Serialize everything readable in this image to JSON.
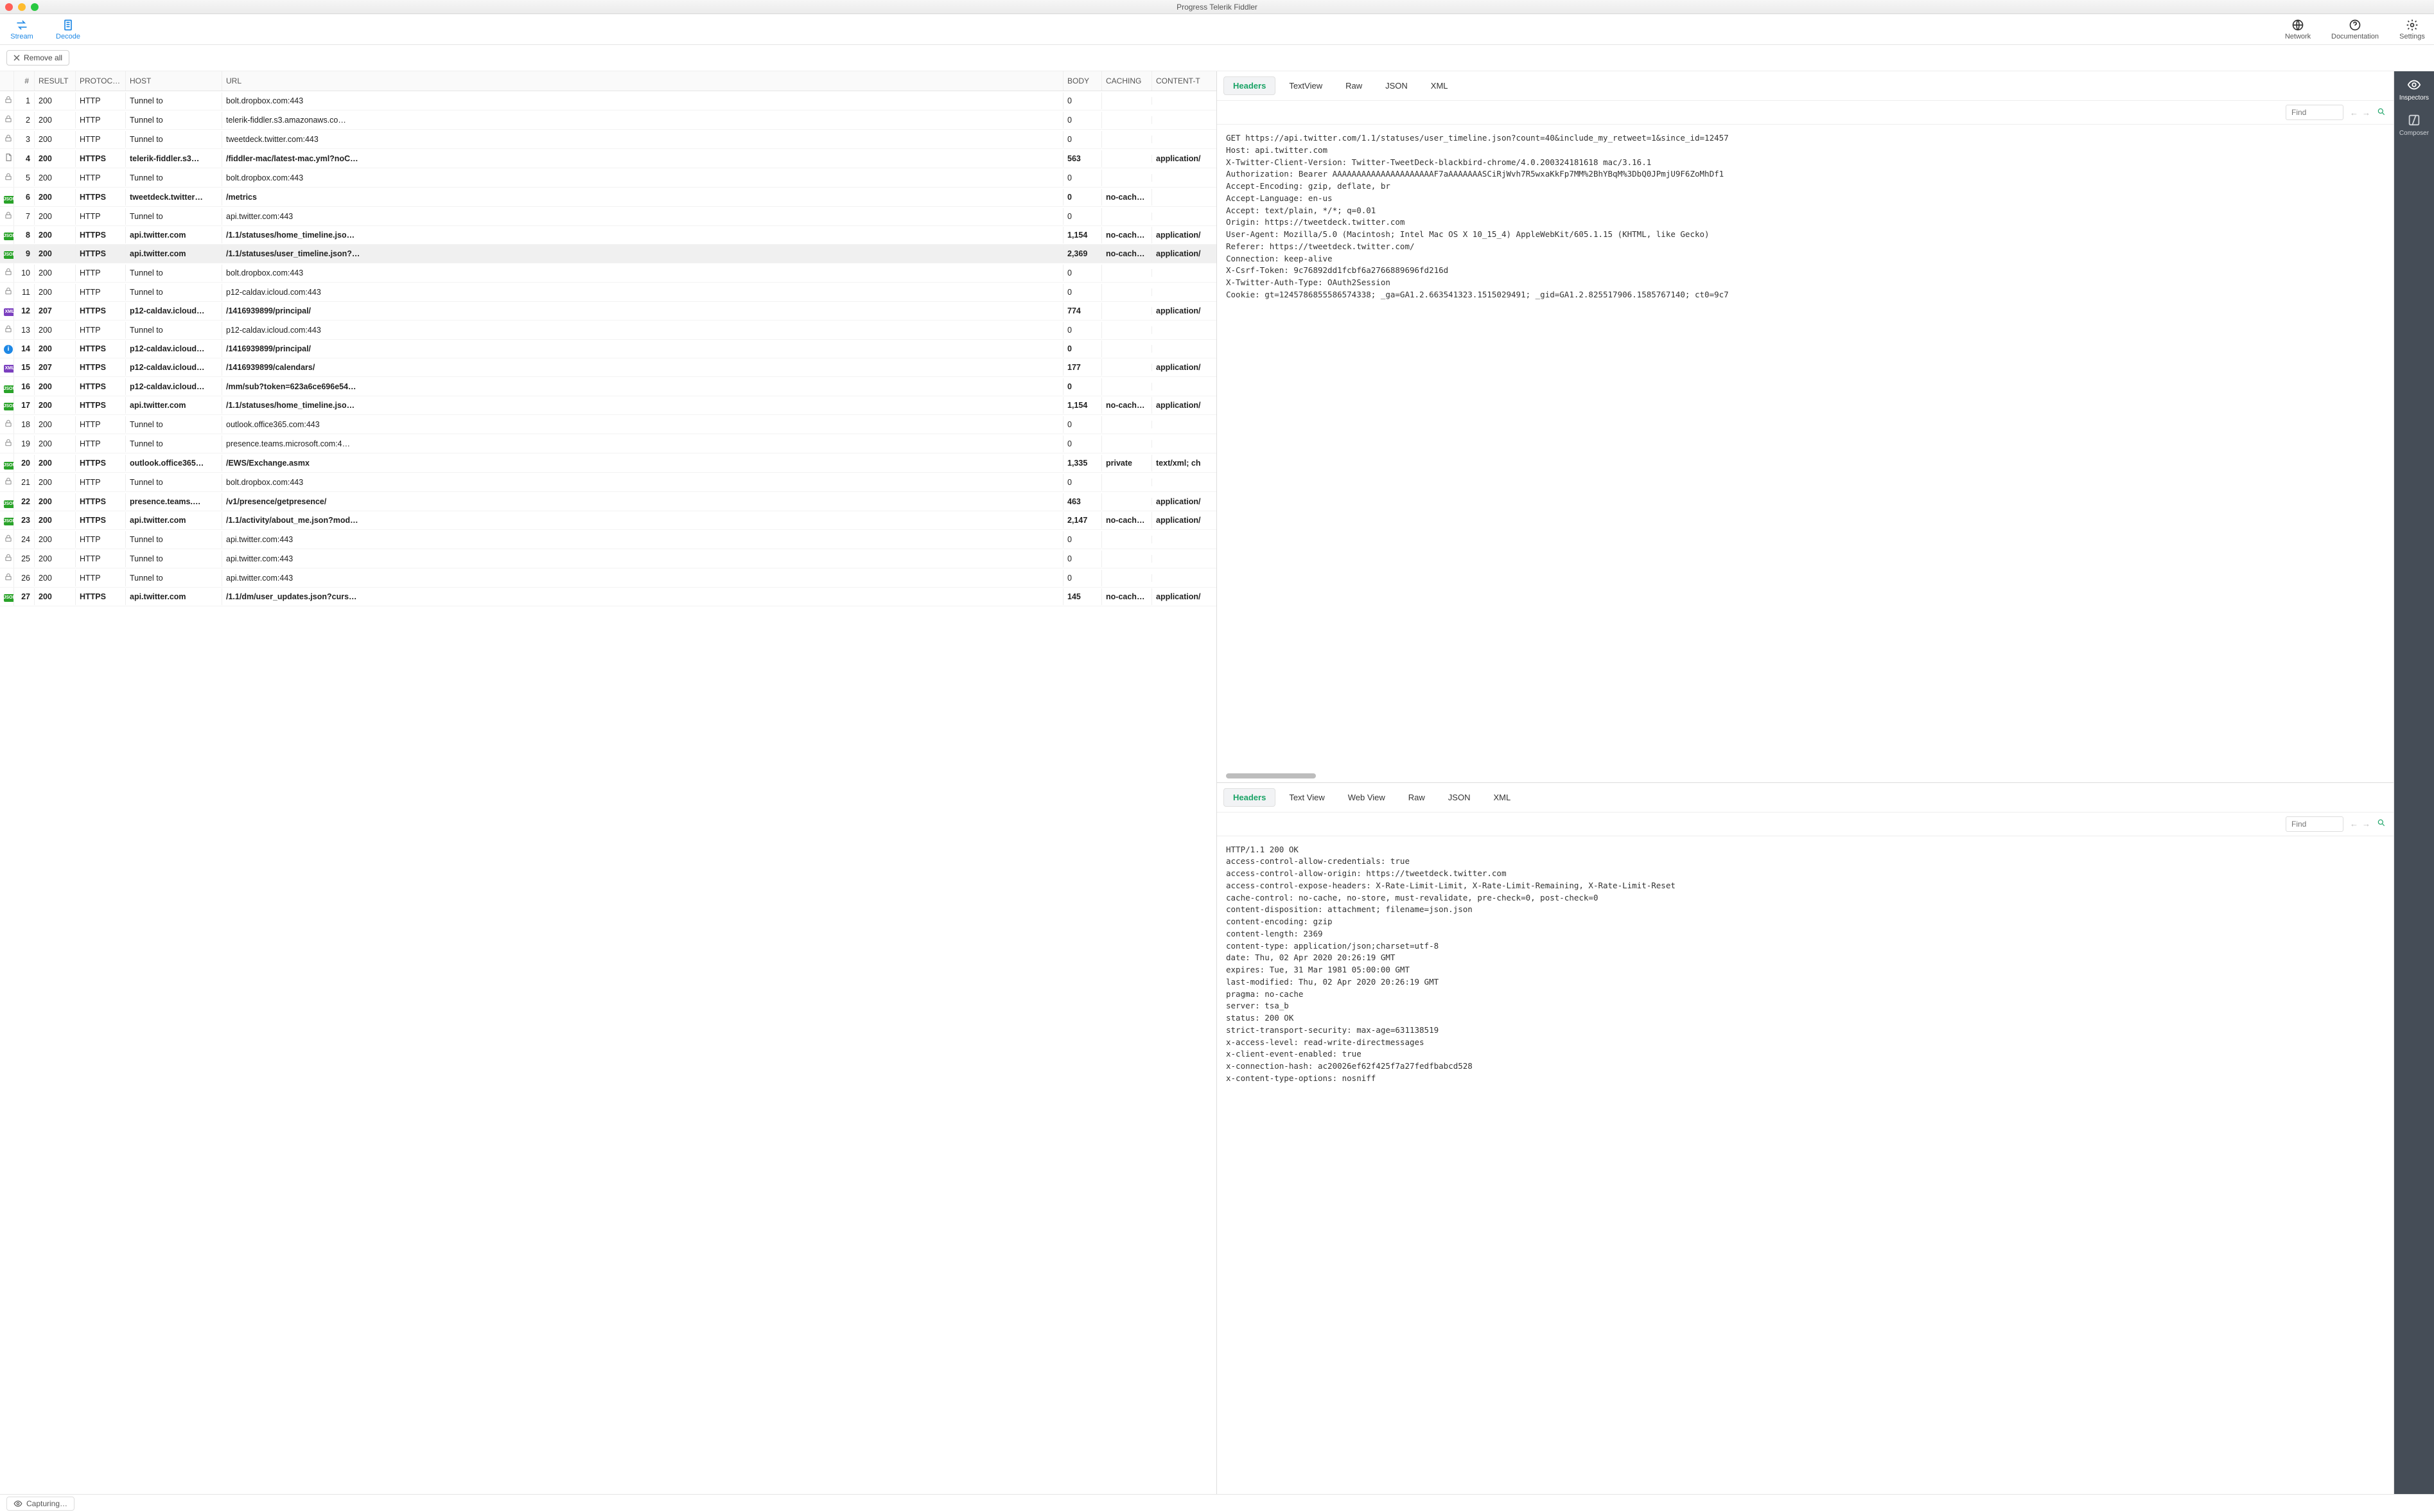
{
  "titlebar": {
    "title": "Progress Telerik Fiddler"
  },
  "toolbar": {
    "stream": "Stream",
    "decode": "Decode",
    "network": "Network",
    "documentation": "Documentation",
    "settings": "Settings"
  },
  "remove_all": "Remove all",
  "sidebar": {
    "inspectors": "Inspectors",
    "composer": "Composer"
  },
  "grid": {
    "headers": {
      "num": "#",
      "result": "RESULT",
      "protocol": "PROTOCOL",
      "host": "HOST",
      "url": "URL",
      "body": "BODY",
      "caching": "CACHING",
      "content_type": "CONTENT-T"
    },
    "rows": [
      {
        "icon": "lock",
        "n": "1",
        "result": "200",
        "proto": "HTTP",
        "host": "Tunnel to",
        "url": "bolt.dropbox.com:443",
        "body": "0",
        "cache": "",
        "ct": ""
      },
      {
        "icon": "lock",
        "n": "2",
        "result": "200",
        "proto": "HTTP",
        "host": "Tunnel to",
        "url": "telerik-fiddler.s3.amazonaws.co…",
        "body": "0",
        "cache": "",
        "ct": ""
      },
      {
        "icon": "lock",
        "n": "3",
        "result": "200",
        "proto": "HTTP",
        "host": "Tunnel to",
        "url": "tweetdeck.twitter.com:443",
        "body": "0",
        "cache": "",
        "ct": ""
      },
      {
        "icon": "doc",
        "n": "4",
        "result": "200",
        "proto": "HTTPS",
        "host": "telerik-fiddler.s3…",
        "url": "/fiddler-mac/latest-mac.yml?noC…",
        "body": "563",
        "cache": "",
        "ct": "application/",
        "bold": true
      },
      {
        "icon": "lock",
        "n": "5",
        "result": "200",
        "proto": "HTTP",
        "host": "Tunnel to",
        "url": "bolt.dropbox.com:443",
        "body": "0",
        "cache": "",
        "ct": ""
      },
      {
        "icon": "jsondot",
        "n": "6",
        "result": "200",
        "proto": "HTTPS",
        "host": "tweetdeck.twitter…",
        "url": "/metrics",
        "body": "0",
        "cache": "no-cache,…",
        "ct": "",
        "bold": true
      },
      {
        "icon": "lock",
        "n": "7",
        "result": "200",
        "proto": "HTTP",
        "host": "Tunnel to",
        "url": "api.twitter.com:443",
        "body": "0",
        "cache": "",
        "ct": ""
      },
      {
        "icon": "json",
        "n": "8",
        "result": "200",
        "proto": "HTTPS",
        "host": "api.twitter.com",
        "url": "/1.1/statuses/home_timeline.jso…",
        "body": "1,154",
        "cache": "no-cache,…",
        "ct": "application/",
        "bold": true
      },
      {
        "icon": "json",
        "n": "9",
        "result": "200",
        "proto": "HTTPS",
        "host": "api.twitter.com",
        "url": "/1.1/statuses/user_timeline.json?…",
        "body": "2,369",
        "cache": "no-cache,…",
        "ct": "application/",
        "bold": true,
        "selected": true
      },
      {
        "icon": "lock",
        "n": "10",
        "result": "200",
        "proto": "HTTP",
        "host": "Tunnel to",
        "url": "bolt.dropbox.com:443",
        "body": "0",
        "cache": "",
        "ct": ""
      },
      {
        "icon": "lock",
        "n": "11",
        "result": "200",
        "proto": "HTTP",
        "host": "Tunnel to",
        "url": "p12-caldav.icloud.com:443",
        "body": "0",
        "cache": "",
        "ct": ""
      },
      {
        "icon": "xml",
        "n": "12",
        "result": "207",
        "proto": "HTTPS",
        "host": "p12-caldav.icloud…",
        "url": "/1416939899/principal/",
        "body": "774",
        "cache": "",
        "ct": "application/",
        "bold": true
      },
      {
        "icon": "lock",
        "n": "13",
        "result": "200",
        "proto": "HTTP",
        "host": "Tunnel to",
        "url": "p12-caldav.icloud.com:443",
        "body": "0",
        "cache": "",
        "ct": ""
      },
      {
        "icon": "info",
        "n": "14",
        "result": "200",
        "proto": "HTTPS",
        "host": "p12-caldav.icloud…",
        "url": "/1416939899/principal/",
        "body": "0",
        "cache": "",
        "ct": "",
        "bold": true
      },
      {
        "icon": "xml",
        "n": "15",
        "result": "207",
        "proto": "HTTPS",
        "host": "p12-caldav.icloud…",
        "url": "/1416939899/calendars/",
        "body": "177",
        "cache": "",
        "ct": "application/",
        "bold": true
      },
      {
        "icon": "jsondot",
        "n": "16",
        "result": "200",
        "proto": "HTTPS",
        "host": "p12-caldav.icloud…",
        "url": "/mm/sub?token=623a6ce696e54…",
        "body": "0",
        "cache": "",
        "ct": "",
        "bold": true
      },
      {
        "icon": "json",
        "n": "17",
        "result": "200",
        "proto": "HTTPS",
        "host": "api.twitter.com",
        "url": "/1.1/statuses/home_timeline.jso…",
        "body": "1,154",
        "cache": "no-cache,…",
        "ct": "application/",
        "bold": true
      },
      {
        "icon": "lock",
        "n": "18",
        "result": "200",
        "proto": "HTTP",
        "host": "Tunnel to",
        "url": "outlook.office365.com:443",
        "body": "0",
        "cache": "",
        "ct": ""
      },
      {
        "icon": "lock",
        "n": "19",
        "result": "200",
        "proto": "HTTP",
        "host": "Tunnel to",
        "url": "presence.teams.microsoft.com:4…",
        "body": "0",
        "cache": "",
        "ct": ""
      },
      {
        "icon": "jsondot",
        "n": "20",
        "result": "200",
        "proto": "HTTPS",
        "host": "outlook.office365…",
        "url": "/EWS/Exchange.asmx",
        "body": "1,335",
        "cache": "private",
        "ct": "text/xml; ch",
        "bold": true
      },
      {
        "icon": "lock",
        "n": "21",
        "result": "200",
        "proto": "HTTP",
        "host": "Tunnel to",
        "url": "bolt.dropbox.com:443",
        "body": "0",
        "cache": "",
        "ct": ""
      },
      {
        "icon": "jsondot",
        "n": "22",
        "result": "200",
        "proto": "HTTPS",
        "host": "presence.teams.…",
        "url": "/v1/presence/getpresence/",
        "body": "463",
        "cache": "",
        "ct": "application/",
        "bold": true
      },
      {
        "icon": "json",
        "n": "23",
        "result": "200",
        "proto": "HTTPS",
        "host": "api.twitter.com",
        "url": "/1.1/activity/about_me.json?mod…",
        "body": "2,147",
        "cache": "no-cache,…",
        "ct": "application/",
        "bold": true
      },
      {
        "icon": "lock",
        "n": "24",
        "result": "200",
        "proto": "HTTP",
        "host": "Tunnel to",
        "url": "api.twitter.com:443",
        "body": "0",
        "cache": "",
        "ct": ""
      },
      {
        "icon": "lock",
        "n": "25",
        "result": "200",
        "proto": "HTTP",
        "host": "Tunnel to",
        "url": "api.twitter.com:443",
        "body": "0",
        "cache": "",
        "ct": ""
      },
      {
        "icon": "lock",
        "n": "26",
        "result": "200",
        "proto": "HTTP",
        "host": "Tunnel to",
        "url": "api.twitter.com:443",
        "body": "0",
        "cache": "",
        "ct": ""
      },
      {
        "icon": "json",
        "n": "27",
        "result": "200",
        "proto": "HTTPS",
        "host": "api.twitter.com",
        "url": "/1.1/dm/user_updates.json?curs…",
        "body": "145",
        "cache": "no-cache,…",
        "ct": "application/",
        "bold": true
      }
    ]
  },
  "request_tabs": [
    "Headers",
    "TextView",
    "Raw",
    "JSON",
    "XML"
  ],
  "response_tabs": [
    "Headers",
    "Text View",
    "Web View",
    "Raw",
    "JSON",
    "XML"
  ],
  "find_placeholder": "Find",
  "request_raw": "GET https://api.twitter.com/1.1/statuses/user_timeline.json?count=40&include_my_retweet=1&since_id=12457\nHost: api.twitter.com\nX-Twitter-Client-Version: Twitter-TweetDeck-blackbird-chrome/4.0.200324181618 mac/3.16.1\nAuthorization: Bearer AAAAAAAAAAAAAAAAAAAAAF7aAAAAAAASCiRjWvh7R5wxaKkFp7MM%2BhYBqM%3DbQ0JPmjU9F6ZoMhDf1\nAccept-Encoding: gzip, deflate, br\nAccept-Language: en-us\nAccept: text/plain, */*; q=0.01\nOrigin: https://tweetdeck.twitter.com\nUser-Agent: Mozilla/5.0 (Macintosh; Intel Mac OS X 10_15_4) AppleWebKit/605.1.15 (KHTML, like Gecko)\nReferer: https://tweetdeck.twitter.com/\nConnection: keep-alive\nX-Csrf-Token: 9c76892dd1fcbf6a2766889696fd216d\nX-Twitter-Auth-Type: OAuth2Session\nCookie: gt=1245786855586574338; _ga=GA1.2.663541323.1515029491; _gid=GA1.2.825517906.1585767140; ct0=9c7",
  "response_raw": "HTTP/1.1 200 OK\naccess-control-allow-credentials: true\naccess-control-allow-origin: https://tweetdeck.twitter.com\naccess-control-expose-headers: X-Rate-Limit-Limit, X-Rate-Limit-Remaining, X-Rate-Limit-Reset\ncache-control: no-cache, no-store, must-revalidate, pre-check=0, post-check=0\ncontent-disposition: attachment; filename=json.json\ncontent-encoding: gzip\ncontent-length: 2369\ncontent-type: application/json;charset=utf-8\ndate: Thu, 02 Apr 2020 20:26:19 GMT\nexpires: Tue, 31 Mar 1981 05:00:00 GMT\nlast-modified: Thu, 02 Apr 2020 20:26:19 GMT\npragma: no-cache\nserver: tsa_b\nstatus: 200 OK\nstrict-transport-security: max-age=631138519\nx-access-level: read-write-directmessages\nx-client-event-enabled: true\nx-connection-hash: ac20026ef62f425f7a27fedfbabcd528\nx-content-type-options: nosniff",
  "status": {
    "capturing": "Capturing…"
  }
}
